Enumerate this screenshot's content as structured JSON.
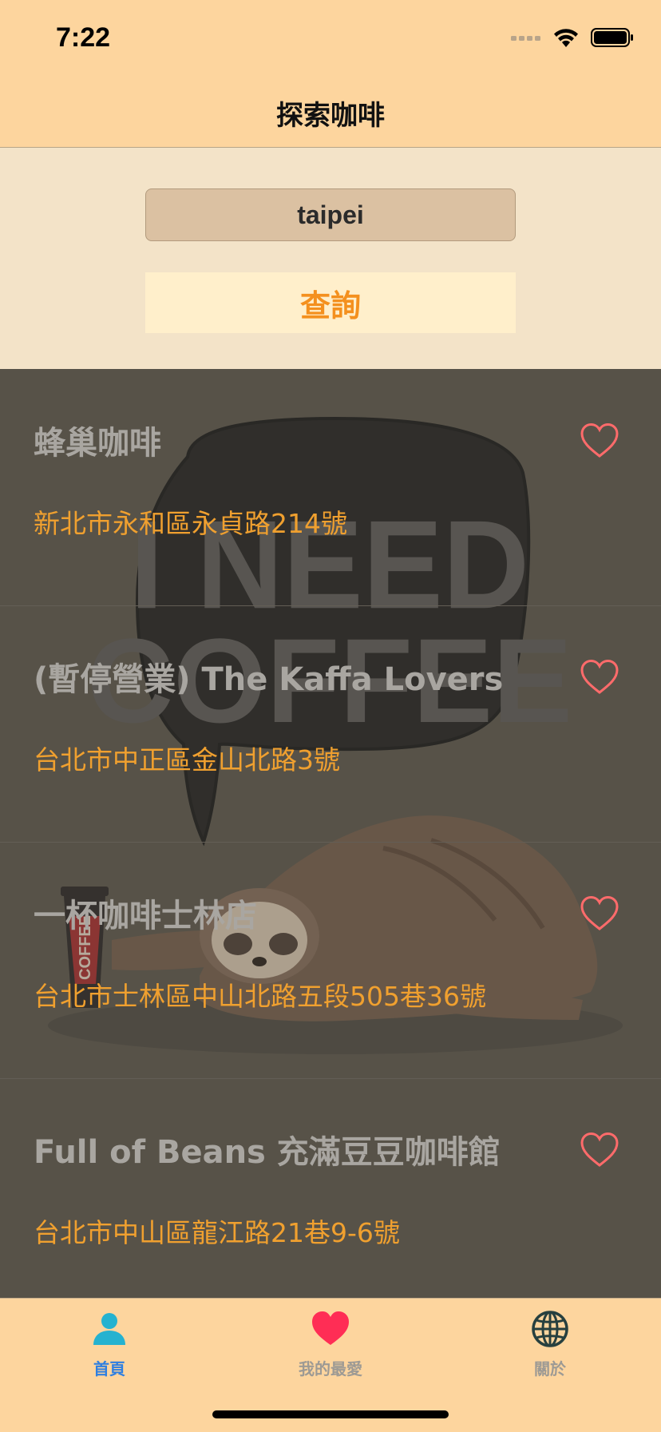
{
  "status_bar": {
    "time": "7:22"
  },
  "nav": {
    "title": "探索咖啡"
  },
  "search": {
    "value": "taipei",
    "button_label": "查詢"
  },
  "shops": [
    {
      "name": "蜂巢咖啡",
      "address": "新北市永和區永貞路214號"
    },
    {
      "name": "(暫停營業) The Kaffa Lovers",
      "address": "台北市中正區金山北路3號"
    },
    {
      "name": "一杯咖啡士林店",
      "address": "台北市士林區中山北路五段505巷36號"
    },
    {
      "name": "Full of Beans 充滿豆豆咖啡館",
      "address": "台北市中山區龍江路21巷9-6號"
    }
  ],
  "background_art": {
    "line1": "I NEED",
    "line2": "COFFEE",
    "cup_text": "COFFEE"
  },
  "tabs": [
    {
      "label": "首頁",
      "icon": "person-icon",
      "color": "#2f7fe0"
    },
    {
      "label": "我的最愛",
      "icon": "heart-icon",
      "color": "#9d9a94"
    },
    {
      "label": "關於",
      "icon": "globe-icon",
      "color": "#9d9a94"
    }
  ],
  "colors": {
    "bar": "#fdd59e",
    "accent_orange": "#f4901e",
    "list_bg": "#575249",
    "heart": "#ff5a6e",
    "address": "#f0a02f"
  }
}
